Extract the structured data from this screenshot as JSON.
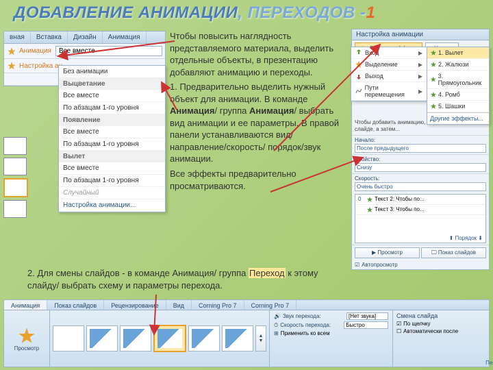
{
  "title": {
    "part1": "Добавление анимации",
    "part2": ", переходов -",
    "num": "1"
  },
  "ribbon": {
    "tabs": [
      "вная",
      "Вставка",
      "Дизайн",
      "Анимация"
    ],
    "anim_label": "Анимация",
    "dropdown_value": "Все вместе",
    "custom": "Настройка ан...",
    "ani": "Ани"
  },
  "dropdown": {
    "no_anim": "Без анимации",
    "sections": [
      {
        "header": "Выцветание",
        "rows": [
          "Все вместе",
          "По абзацам 1-го уровня"
        ]
      },
      {
        "header": "Появление",
        "rows": [
          "Все вместе",
          "По абзацам 1-го уровня"
        ]
      },
      {
        "header": "Вылет",
        "rows": [
          "Все вместе",
          "По абзацам 1-го уровня"
        ]
      }
    ],
    "random": "Случайный",
    "settings": "Настройка анимации..."
  },
  "anim_panel": {
    "title": "Настройка анимации",
    "add_effect": "Добавить эффект",
    "remove": "Удалить",
    "effect_menu": [
      {
        "icon": "enter",
        "label": "Вход"
      },
      {
        "icon": "emphasis",
        "label": "Выделение"
      },
      {
        "icon": "exit",
        "label": "Выход"
      },
      {
        "icon": "path",
        "label": "Пути перемещения"
      }
    ],
    "effect_sub": [
      "1. Вылет",
      "2. Жалюзи",
      "3. Прямоугольник",
      "4. Ромб",
      "5. Шашки"
    ],
    "effect_sub_more": "Другие эффекты...",
    "hint": "Чтобы добавить анимацию, выделите элемент на слайде, а затем...",
    "start_label": "Начало:",
    "start_value": "После предыдущего",
    "property_label": "Свойство:",
    "property_value": "Снизу",
    "speed_label": "Скорость:",
    "speed_value": "Очень быстро",
    "list": [
      {
        "n": "0",
        "text": "Текст 2: Чтобы по..."
      },
      {
        "n": "",
        "text": "Текст 3: Чтобы по..."
      }
    ],
    "reorder": "Порядок",
    "view": "Просмотр",
    "show": "Показ слайдов",
    "autopreview": "Автопросмотр"
  },
  "body": {
    "p1": "Чтобы повысить наглядность представляемого материала, выделить отдельные объекты, в презентацию добавляют анимацию и переходы.",
    "p2_a": "1. Предварительно выделить нужный объект для анимации. В команде ",
    "p2_b": "Анимация",
    "p2_c": "/ группа ",
    "p2_d": "Анимация",
    "p2_e": "/ выбрать вид анимации и ее параметры. В правой панели устанавливаются вид/направление/скорость/ порядок/звук анимации.",
    "p3": "Все эффекты предварительно просматриваются.",
    "p4_a": "2. Для смены слайдов - в команде Анимация/ группа ",
    "p4_b": "Переход",
    "p4_c": " к этому слайду/ выбрать схему и параметры перехода."
  },
  "bottom": {
    "tabs": [
      "Анимация",
      "Показ слайдов",
      "Рецензирование",
      "Вид",
      "Corning Pro 7",
      "Corning Pro 7"
    ],
    "preview": "Просмотр",
    "sound": "Звук перехода:",
    "sound_val": "[Нет звука]",
    "speed": "Скорость перехода:",
    "speed_val": "Быстро",
    "apply_all": "Применить ко всем",
    "change": "Смена слайда",
    "by_click": "По щелчку",
    "auto_after": "Автоматически после",
    "group_label": "Переход к этому слайду"
  }
}
